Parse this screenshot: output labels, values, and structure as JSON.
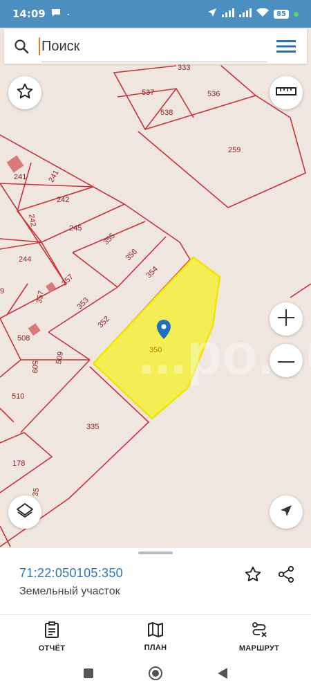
{
  "status_bar": {
    "time": "14:09",
    "battery": "85"
  },
  "search": {
    "placeholder": "Поиск"
  },
  "map": {
    "parcels": [
      "333",
      "537",
      "536",
      "538",
      "259",
      "241",
      "241",
      "242",
      "242",
      "245",
      "244",
      "355",
      "356",
      "354",
      "357",
      "357",
      "353",
      "352",
      "350",
      "508",
      "509",
      "509",
      "510",
      "335",
      "178",
      "35",
      "9"
    ],
    "watermark": "...ро...бл"
  },
  "sheet": {
    "cadastral_number": "71:22:050105:350",
    "object_type": "Земельный участок"
  },
  "bottom_nav": {
    "report_label": "ОТЧЁТ",
    "plan_label": "ПЛАН",
    "route_label": "МАРШРУТ"
  },
  "colors": {
    "accent": "#4a8fbf",
    "parcel_line": "#c8323a",
    "selected_fill": "#f2ef3c",
    "link": "#2f74b5"
  }
}
